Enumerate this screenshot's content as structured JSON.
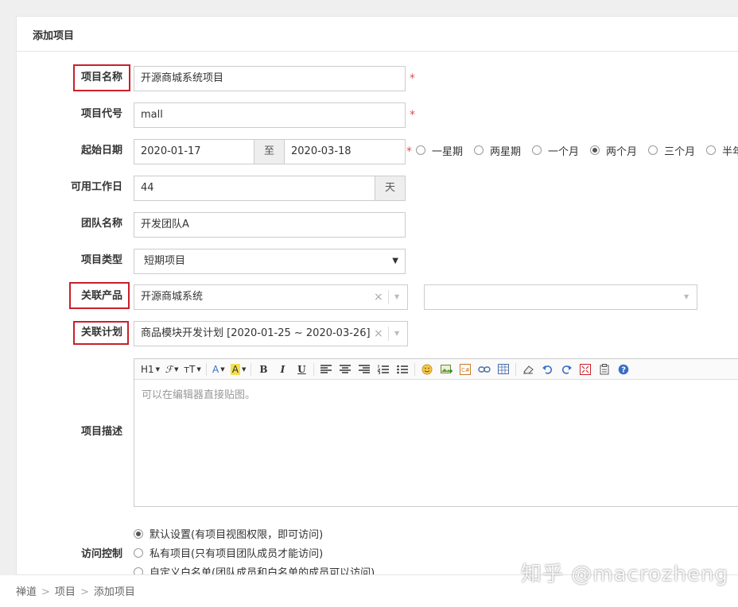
{
  "panel": {
    "title": "添加项目"
  },
  "form": {
    "name": {
      "label": "项目名称",
      "value": "开源商城系统项目",
      "required": "*"
    },
    "code": {
      "label": "项目代号",
      "value": "mall",
      "required": "*"
    },
    "dates": {
      "label": "起始日期",
      "begin": "2020-01-17",
      "sep": "至",
      "end": "2020-03-18",
      "required": "*",
      "ranges": [
        {
          "label": "一星期",
          "checked": false
        },
        {
          "label": "两星期",
          "checked": false
        },
        {
          "label": "一个月",
          "checked": false
        },
        {
          "label": "两个月",
          "checked": true
        },
        {
          "label": "三个月",
          "checked": false
        },
        {
          "label": "半年",
          "checked": false
        }
      ]
    },
    "days": {
      "label": "可用工作日",
      "value": "44",
      "unit": "天"
    },
    "team": {
      "label": "团队名称",
      "value": "开发团队A"
    },
    "type": {
      "label": "项目类型",
      "value": "短期项目"
    },
    "products": {
      "label": "关联产品",
      "value": "开源商城系统",
      "clear": "×"
    },
    "plan": {
      "label": "关联计划",
      "value": "商品模块开发计划 [2020-01-25 ~ 2020-03-26]",
      "clear": "×"
    },
    "desc": {
      "label": "项目描述",
      "placeholder": "可以在编辑器直接贴图。",
      "toolbar": {
        "heading": "H1",
        "font": "ℱ",
        "size": "тT",
        "color": "A",
        "bg": "A",
        "bold": "B",
        "italic": "I",
        "underline": "U"
      }
    },
    "acl": {
      "label": "访问控制",
      "options": [
        {
          "label": "默认设置(有项目视图权限，即可访问)",
          "checked": true
        },
        {
          "label": "私有项目(只有项目团队成员才能访问)",
          "checked": false
        },
        {
          "label": "自定义白名单(团队成员和白名单的成员可以访问)",
          "checked": false
        }
      ]
    }
  },
  "breadcrumb": {
    "items": [
      "禅道",
      "项目",
      "添加项目"
    ],
    "sep": ">"
  },
  "watermark": "知乎 @macrozheng",
  "colors": {
    "highlight": "#c9202a",
    "required": "#d9534f"
  }
}
